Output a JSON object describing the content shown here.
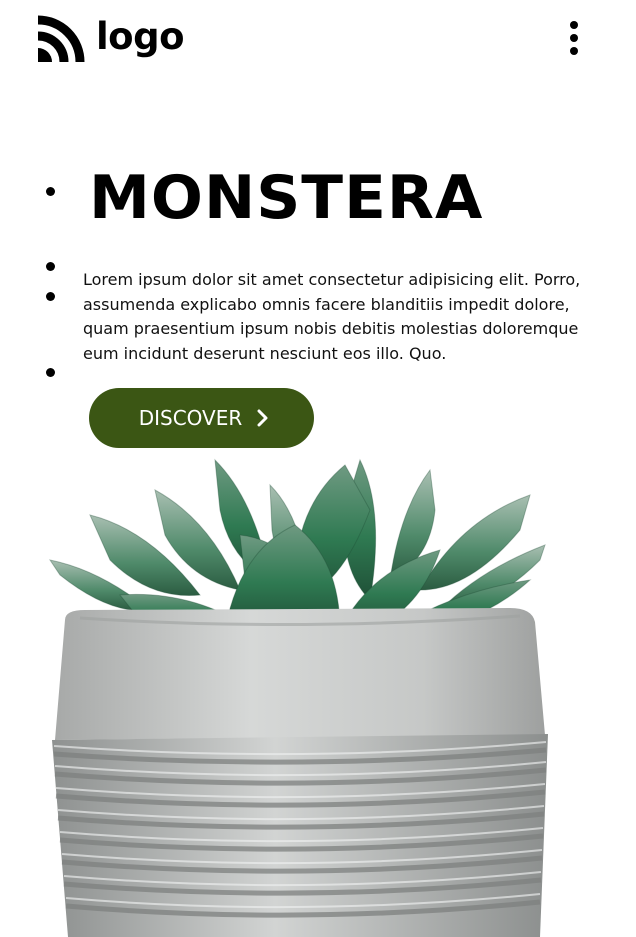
{
  "header": {
    "logo_text": "logo",
    "logo_icon": "wifi-arcs-icon",
    "menu_icon": "vertical-ellipsis-icon"
  },
  "hero": {
    "title": "MONSTERA",
    "description": "Lorem ipsum dolor sit amet consectetur adipisicing elit. Porro, assumenda explicabo omnis facere blanditiis impedit dolore, quam praesentium ipsum nobis debitis molestias doloremque eum incidunt deserunt nesciunt eos illo. Quo.",
    "button_label": "DISCOVER",
    "button_icon": "chevron-right-icon"
  },
  "colors": {
    "accent": "#3b5614",
    "text": "#000000",
    "background": "#ffffff"
  }
}
